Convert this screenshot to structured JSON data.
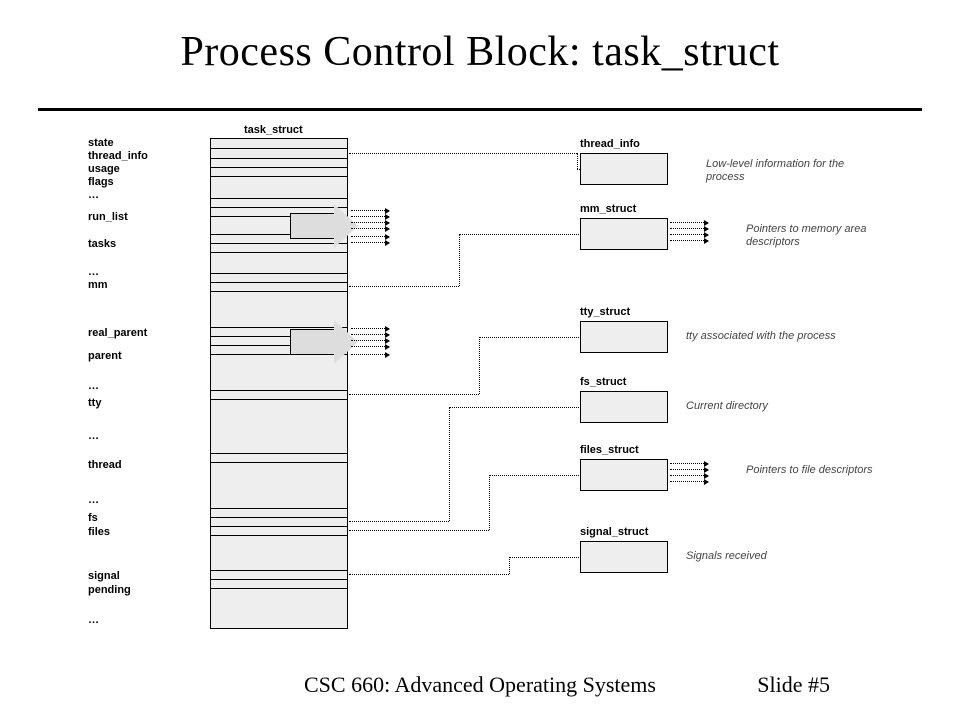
{
  "title": "Process Control Block: task_struct",
  "footer_center": "CSC 660: Advanced Operating Systems",
  "footer_right": "Slide #5",
  "column_label": "task_struct",
  "fields": {
    "state": "state",
    "thread_info": "thread_info",
    "usage": "usage",
    "flags": "flags",
    "ell1": "…",
    "run_list": "run_list",
    "tasks": "tasks",
    "ell2": "…",
    "mm": "mm",
    "real_parent": "real_parent",
    "parent": "parent",
    "ell3": "…",
    "tty": "tty",
    "ell4": "…",
    "thread": "thread",
    "ell5": "…",
    "fs": "fs",
    "files": "files",
    "signal": "signal",
    "pending": "pending",
    "ell6": "…"
  },
  "sub": {
    "thread_info": {
      "name": "thread_info",
      "desc": "Low-level information\nfor the process"
    },
    "mm_struct": {
      "name": "mm_struct",
      "desc": "Pointers to memory\narea descriptors"
    },
    "tty_struct": {
      "name": "tty_struct",
      "desc": "tty associated with the process"
    },
    "fs_struct": {
      "name": "fs_struct",
      "desc": "Current directory"
    },
    "files_struct": {
      "name": "files_struct",
      "desc": "Pointers to file\ndescriptors"
    },
    "signal_struct": {
      "name": "signal_struct",
      "desc": "Signals received"
    }
  }
}
